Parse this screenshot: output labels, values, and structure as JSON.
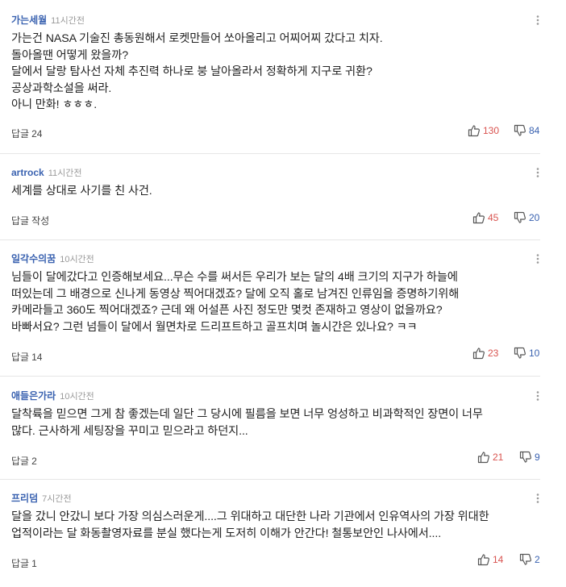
{
  "comments": [
    {
      "nickname": "가는세월",
      "time": "11시간전",
      "text": "가는건 NASA 기술진 총동원해서 로켓만들어 쏘아올리고 어찌어찌 갔다고 치자.\n돌아올땐 어떻게 왔을까?\n달에서 달랑 탐사선 자체 추진력 하나로 붕 날아올라서 정확하게 지구로 귀환?\n공상과학소설을 써라.\n아니 만화! ㅎㅎㅎ.",
      "reply_label": "답글",
      "reply_count": "24",
      "likes": "130",
      "dislikes": "84"
    },
    {
      "nickname": "artrock",
      "time": "11시간전",
      "text": "세계를 상대로 사기를 친 사건.",
      "reply_label": "답글",
      "reply_count": "작성",
      "likes": "45",
      "dislikes": "20"
    },
    {
      "nickname": "일각수의꿈",
      "time": "10시간전",
      "text": "님들이 달에갔다고 인증해보세요...무슨 수를 써서든 우리가 보는 달의 4배 크기의 지구가 하늘에\n떠있는데 그 배경으로 신나게 동영상 찍어대겠죠?  달에 오직 홀로 남겨진 인류임을 증명하기위해\n카메라들고 360도 찍어대겠죠?  근데 왜 어설픈 사진 정도만 몇컷 존재하고 영상이 없을까요?\n바빠서요? 그런 넘들이 달에서 월면차로 드리프트하고 골프치며 놀시간은 있나요? ㅋㅋ",
      "reply_label": "답글",
      "reply_count": "14",
      "likes": "23",
      "dislikes": "10"
    },
    {
      "nickname": "애들은가라",
      "time": "10시간전",
      "text": "달착륙을 믿으면 그게 참 좋겠는데 일단 그 당시에 필름을 보면 너무 엉성하고 비과학적인 장면이 너무\n많다. 근사하게 세팅장을 꾸미고 믿으라고 하던지...",
      "reply_label": "답글",
      "reply_count": "2",
      "likes": "21",
      "dislikes": "9"
    },
    {
      "nickname": "프리덤",
      "time": "7시간전",
      "text": "달을 갔니 안갔니 보다 가장 의심스러운게....그 위대하고 대단한 나라 기관에서 인유역사의 가장 위대한\n업적이라는 달 화동촬영자료를 분실 했다는게 도저히 이해가 안간다! 철통보안인 나사에서....",
      "reply_label": "답글",
      "reply_count": "1",
      "likes": "14",
      "dislikes": "2"
    }
  ],
  "icons": {
    "more": "more-vertical-icon",
    "like": "thumbs-up-icon",
    "dislike": "thumbs-down-icon"
  },
  "colors": {
    "nickname": "#3a62b0",
    "like": "#d9534f",
    "dislike": "#3a62b0",
    "divider": "#e6e6e6"
  }
}
